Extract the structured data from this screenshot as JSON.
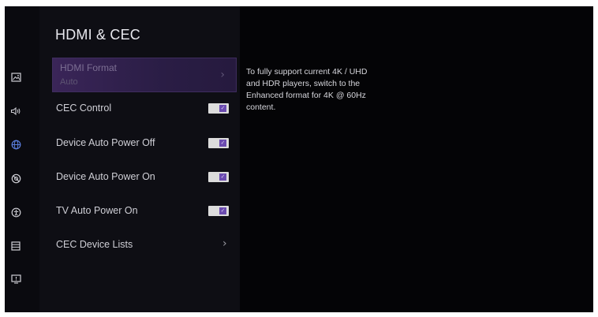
{
  "panel": {
    "title": "HDMI & CEC"
  },
  "menu": {
    "items": [
      {
        "label": "HDMI Format",
        "value": "Auto",
        "control": "chevron"
      },
      {
        "label": "CEC Control",
        "control": "toggle",
        "checked": true
      },
      {
        "label": "Device Auto Power Off",
        "control": "toggle",
        "checked": true
      },
      {
        "label": "Device Auto Power On",
        "control": "toggle",
        "checked": true
      },
      {
        "label": "TV Auto Power On",
        "control": "toggle",
        "checked": true
      },
      {
        "label": "CEC Device Lists",
        "control": "chevron"
      }
    ]
  },
  "help": {
    "text": "To fully support current 4K / UHD and HDR players, switch to the Enhanced format for 4K @ 60Hz content."
  },
  "sidebar": {
    "icons": [
      {
        "name": "picture-icon"
      },
      {
        "name": "sound-icon"
      },
      {
        "name": "network-icon",
        "active": true
      },
      {
        "name": "privacy-icon"
      },
      {
        "name": "accessibility-icon"
      },
      {
        "name": "system-icon"
      },
      {
        "name": "support-icon"
      }
    ]
  },
  "colors": {
    "accent": "#6b4bb0",
    "focus_background": "#3a2558",
    "active_icon": "#5b7fe0"
  },
  "glyphs": {
    "chevron": "›",
    "check": "✓"
  }
}
